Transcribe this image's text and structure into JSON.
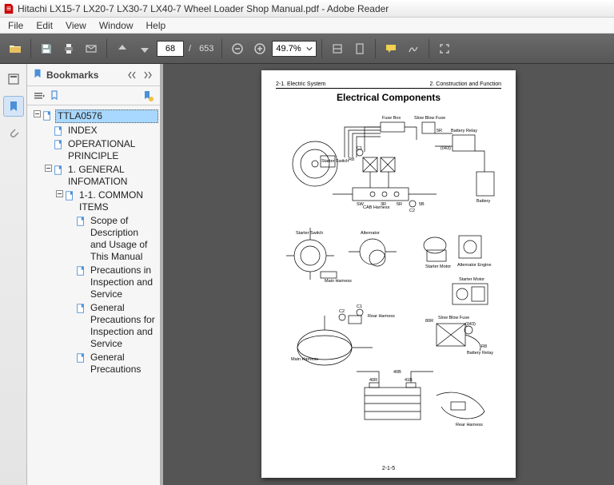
{
  "titlebar": {
    "text": "Hitachi LX15-7 LX20-7 LX30-7 LX40-7 Wheel Loader Shop Manual.pdf - Adobe Reader"
  },
  "menu": {
    "items": [
      "File",
      "Edit",
      "View",
      "Window",
      "Help"
    ]
  },
  "toolbar": {
    "page_current": "68",
    "page_sep": "/",
    "page_total": "653",
    "zoom_value": "49.7%"
  },
  "panel": {
    "title": "Bookmarks"
  },
  "bookmarks": [
    {
      "level": 0,
      "twisty": "minus",
      "label": "TTLA0576",
      "selected": true
    },
    {
      "level": 1,
      "twisty": "none",
      "label": "INDEX"
    },
    {
      "level": 1,
      "twisty": "none",
      "label": "OPERATIONAL PRINCIPLE"
    },
    {
      "level": 1,
      "twisty": "minus",
      "label": "1. GENERAL INFOMATION"
    },
    {
      "level": 2,
      "twisty": "minus",
      "label": "1-1. COMMON ITEMS"
    },
    {
      "level": 3,
      "twisty": "none",
      "label": "Scope of Description and Usage of This Manual"
    },
    {
      "level": 3,
      "twisty": "none",
      "label": "Precautions in Inspection and Service"
    },
    {
      "level": 3,
      "twisty": "none",
      "label": "General Precautions for Inspection and Service"
    },
    {
      "level": 3,
      "twisty": "none",
      "label": "General Precautions"
    }
  ],
  "page": {
    "header_left": "2-1. Electric System",
    "header_right": "2. Construction and Function",
    "title": "Electrical Components",
    "footer": "2-1-5",
    "labels": {
      "fuse_box": "Fuse Box",
      "slow_blow_fuse": "Slow Blow Fuse",
      "battery_relay": "Battery Relay",
      "starter_switch": "Starter Switch",
      "c1": "C1",
      "c2": "C2",
      "r8": "R8",
      "sw": "SW",
      "battery": "Battery",
      "cab_harness": "CAB Harness",
      "alternator": "Alternator",
      "starter_motor": "Starter Motor",
      "alternator_engine": "Alternator Engine",
      "main_harness": "Main Harness",
      "rear_harness": "Rear Harness",
      "d43": "(043)",
      "num_3r": "3R",
      "num_5b": "5B",
      "num_5r": "5R",
      "num_40b": "40B",
      "num_40r": "40R",
      "num_41b": "41B",
      "num_80r": "80R"
    }
  }
}
